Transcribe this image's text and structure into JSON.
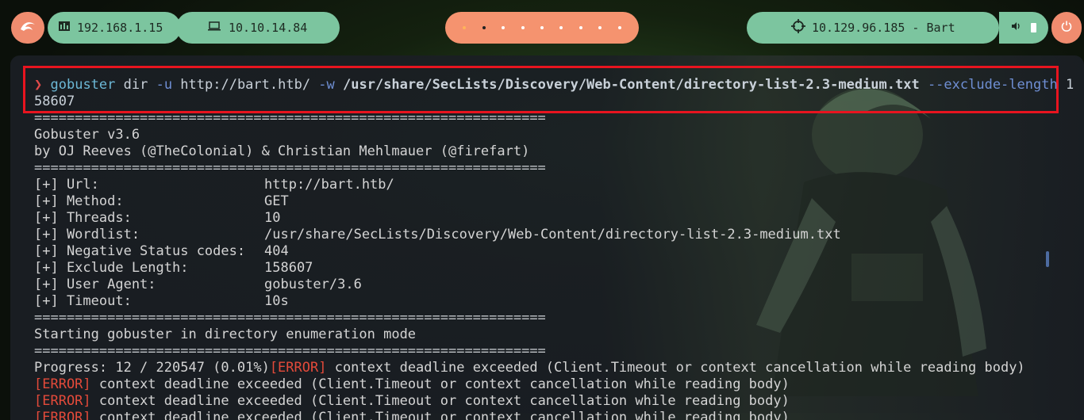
{
  "topbar": {
    "kali_icon": "kali-dragon-icon",
    "local_ip": "192.168.1.15",
    "vpn_ip": "10.10.14.84",
    "target": "10.129.96.185 - Bart",
    "workspaces": 9
  },
  "terminal": {
    "prompt_symbol": "❯",
    "command": {
      "name": "gobuster",
      "subcommand": " dir ",
      "flag_u": "-u",
      "url": " http://bart.htb/ ",
      "flag_w": "-w",
      "wordlist": " /usr/share/SecLists/Discovery/Web-Content/directory-list-2.3-medium.txt ",
      "flag_exclude": "--exclude-length",
      "exclude_part1": " 1",
      "exclude_part2": "58607"
    },
    "separator": "===============================================================",
    "banner_line1": "Gobuster v3.6",
    "banner_line2": "by OJ Reeves (@TheColonial) & Christian Mehlmauer (@firefart)",
    "config": [
      {
        "key": "[+] Url:",
        "value": "http://bart.htb/"
      },
      {
        "key": "[+] Method:",
        "value": "GET"
      },
      {
        "key": "[+] Threads:",
        "value": "10"
      },
      {
        "key": "[+] Wordlist:",
        "value": "/usr/share/SecLists/Discovery/Web-Content/directory-list-2.3-medium.txt"
      },
      {
        "key": "[+] Negative Status codes:",
        "value": "404"
      },
      {
        "key": "[+] Exclude Length:",
        "value": "158607"
      },
      {
        "key": "[+] User Agent:",
        "value": "gobuster/3.6"
      },
      {
        "key": "[+] Timeout:",
        "value": "10s"
      }
    ],
    "starting": "Starting gobuster in directory enumeration mode",
    "progress": "Progress: 12 / 220547 (0.01%)",
    "error_tag": "[ERROR]",
    "error_msg": " context deadline exceeded (Client.Timeout or context cancellation while reading body)"
  }
}
